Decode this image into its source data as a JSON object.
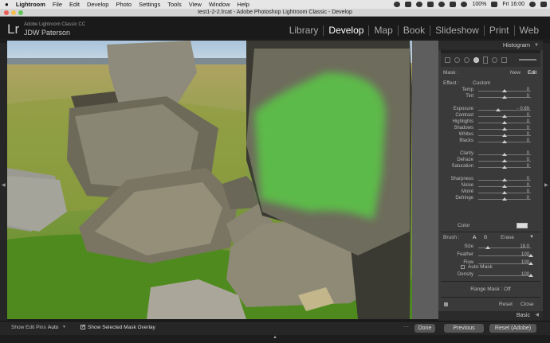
{
  "menubar": {
    "apple": "",
    "items": [
      "Lightroom",
      "File",
      "Edit",
      "Develop",
      "Photo",
      "Settings",
      "Tools",
      "View",
      "Window",
      "Help"
    ],
    "battery": "100%",
    "day": "Fri 16:00"
  },
  "window": {
    "title": "test1-2-2.lrcat - Adobe Photoshop Lightroom Classic - Develop"
  },
  "identity": {
    "logo": "Lr",
    "product": "Adobe Lightroom Classic CC",
    "user": "JDW Paterson"
  },
  "modules": [
    {
      "label": "Library",
      "active": false
    },
    {
      "label": "Develop",
      "active": true
    },
    {
      "label": "Map",
      "active": false
    },
    {
      "label": "Book",
      "active": false
    },
    {
      "label": "Slideshow",
      "active": false
    },
    {
      "label": "Print",
      "active": false
    },
    {
      "label": "Web",
      "active": false
    }
  ],
  "panel": {
    "title": "Histogram",
    "mask_label": "Mask :",
    "mask_new": "New",
    "mask_edit": "Edit",
    "effect_label": "Effect :",
    "effect_value": "Custom",
    "sliders": [
      {
        "label": "Temp",
        "value": "0"
      },
      {
        "label": "Tint",
        "value": "0"
      },
      {
        "label": "Exposure",
        "value": "- 0.89"
      },
      {
        "label": "Contrast",
        "value": "0"
      },
      {
        "label": "Highlights",
        "value": "0"
      },
      {
        "label": "Shadows",
        "value": "0"
      },
      {
        "label": "Whites",
        "value": "0"
      },
      {
        "label": "Blacks",
        "value": "0"
      },
      {
        "label": "Clarity",
        "value": "0"
      },
      {
        "label": "Dehaze",
        "value": "0"
      },
      {
        "label": "Saturation",
        "value": "0"
      },
      {
        "label": "Sharpness",
        "value": "0"
      },
      {
        "label": "Noise",
        "value": "0"
      },
      {
        "label": "Moiré",
        "value": "0"
      },
      {
        "label": "Defringe",
        "value": "0"
      }
    ],
    "color_label": "Color",
    "brush_label": "Brush :",
    "brush_a": "A",
    "brush_b": "B",
    "brush_erase": "Erase",
    "brush": [
      {
        "label": "Size",
        "value": "18.0"
      },
      {
        "label": "Feather",
        "value": "100"
      },
      {
        "label": "Flow",
        "value": "100"
      }
    ],
    "automask": "Auto Mask",
    "density": {
      "label": "Density",
      "value": "100"
    },
    "range_mask": "Range Mask : Off",
    "reset": "Reset",
    "close": "Close",
    "basic": "Basic"
  },
  "toolbar": {
    "show_edit_pins_label": "Show Edit Pins :",
    "show_edit_pins_value": "Auto",
    "overlay_label": "Show Selected Mask Overlay",
    "done": "Done",
    "previous": "Previous",
    "reset_adobe": "Reset (Adobe)"
  }
}
